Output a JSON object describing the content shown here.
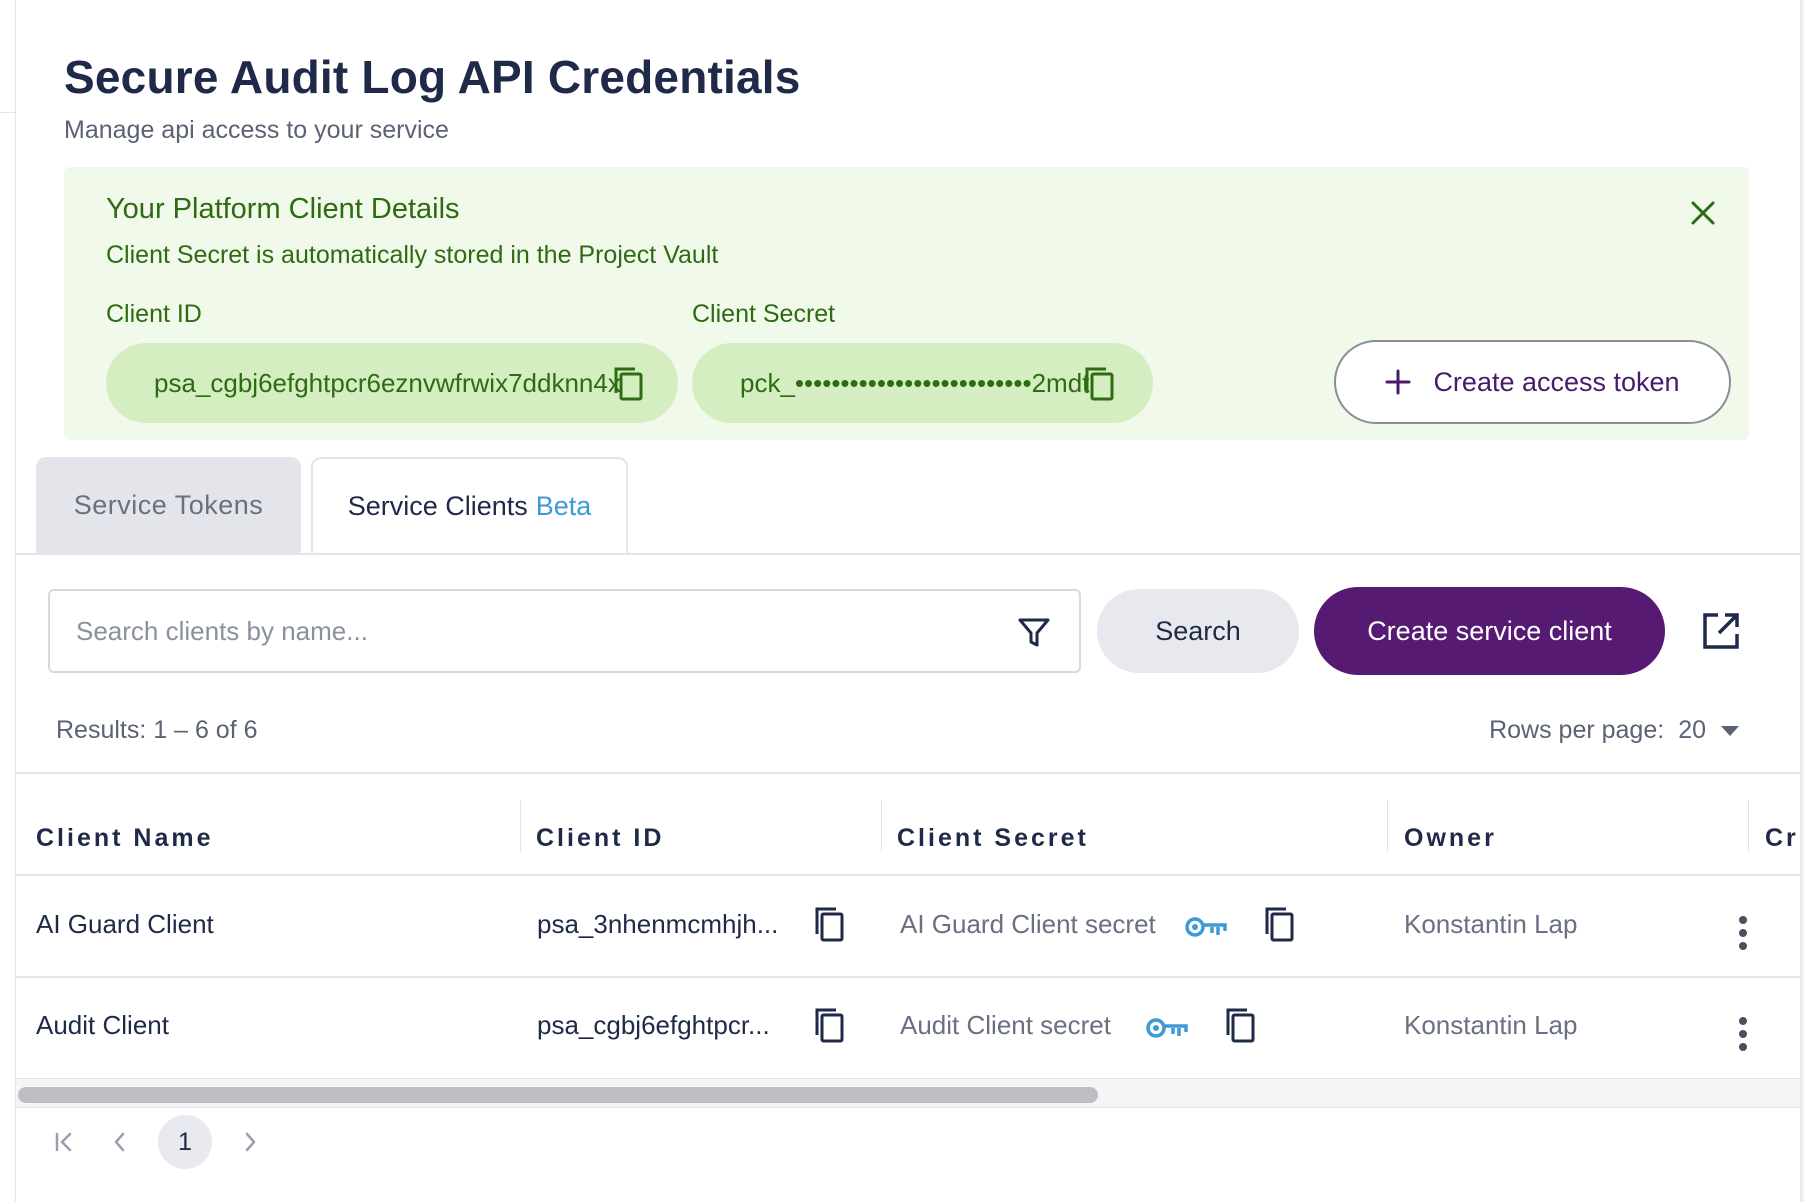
{
  "header": {
    "title": "Secure Audit Log API Credentials",
    "subtitle": "Manage api access to your service"
  },
  "banner": {
    "title": "Your Platform Client Details",
    "text": "Client Secret is automatically stored in the Project Vault",
    "client_id_label": "Client ID",
    "client_id_value": "psa_cgbj6efghtpcr6eznvwfrwix7ddknn4x",
    "client_secret_label": "Client Secret",
    "client_secret_value": "pck_••••••••••••••••••••••••••2mdt",
    "create_token_label": "Create access token",
    "accent_color": "#2e6b12",
    "background_color": "#f1f9ea"
  },
  "tabs": [
    {
      "label": "Service Tokens",
      "active": false
    },
    {
      "label": "Service Clients",
      "badge": "Beta",
      "active": true
    }
  ],
  "toolbar": {
    "search_placeholder": "Search clients by name...",
    "search_value": "",
    "search_button": "Search",
    "create_button": "Create service client",
    "primary_color": "#561a72",
    "icons": [
      "filter-icon",
      "external-link-icon"
    ]
  },
  "results": {
    "summary": "Results: 1 – 6 of 6",
    "rows_per_page_label": "Rows per page:",
    "rows_per_page_value": "20"
  },
  "table": {
    "columns": [
      "Client Name",
      "Client ID",
      "Client Secret",
      "Owner",
      "Cr"
    ],
    "rows": [
      {
        "name": "AI Guard Client",
        "client_id": "psa_3nhenmcmhjh...",
        "secret": "AI Guard Client secret",
        "owner": "Konstantin Lap"
      },
      {
        "name": "Audit Client",
        "client_id": "psa_cgbj6efghtpcr...",
        "secret": "Audit Client secret",
        "owner": "Konstantin Lap"
      }
    ]
  },
  "pagination": {
    "current_page": "1"
  }
}
